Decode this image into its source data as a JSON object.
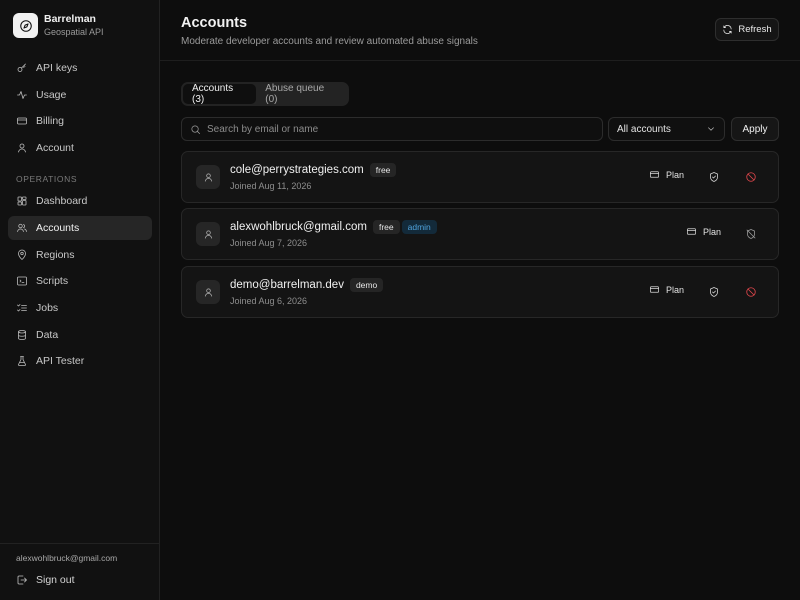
{
  "brand": {
    "name": "Barrelman",
    "subtitle": "Geospatial API",
    "logo_icon": "compass-icon"
  },
  "nav": {
    "items": [
      {
        "label": "API keys",
        "icon": "key-icon"
      },
      {
        "label": "Usage",
        "icon": "activity-icon"
      },
      {
        "label": "Billing",
        "icon": "credit-card-icon"
      },
      {
        "label": "Account",
        "icon": "user-icon"
      }
    ],
    "section_label": "OPERATIONS",
    "ops_items": [
      {
        "label": "Dashboard",
        "icon": "dashboard-icon"
      },
      {
        "label": "Accounts",
        "icon": "users-icon",
        "active": true
      },
      {
        "label": "Regions",
        "icon": "map-pin-icon"
      },
      {
        "label": "Scripts",
        "icon": "code-icon"
      },
      {
        "label": "Jobs",
        "icon": "list-checks-icon"
      },
      {
        "label": "Data",
        "icon": "database-icon"
      },
      {
        "label": "API Tester",
        "icon": "flask-icon"
      }
    ]
  },
  "footer": {
    "user_email": "alexwohlbruck@gmail.com",
    "signout_label": "Sign out"
  },
  "header": {
    "title": "Accounts",
    "subtitle": "Moderate developer accounts and review automated abuse signals",
    "refresh_label": "Refresh"
  },
  "tabs": [
    {
      "label": "Accounts (3)",
      "active": true
    },
    {
      "label": "Abuse queue (0)",
      "active": false
    }
  ],
  "filters": {
    "search_placeholder": "Search by email or name",
    "search_value": "",
    "select_value": "All accounts",
    "apply_label": "Apply"
  },
  "accounts": [
    {
      "email": "cole@perrystrategies.com",
      "badges": [
        "free"
      ],
      "joined": "Joined Aug 11, 2026",
      "plan_label": "Plan",
      "actions": [
        "grant-admin",
        "ban"
      ]
    },
    {
      "email": "alexwohlbruck@gmail.com",
      "badges": [
        "free",
        "admin"
      ],
      "joined": "Joined Aug 7, 2026",
      "plan_label": "Plan",
      "actions": [
        "revoke-admin"
      ]
    },
    {
      "email": "demo@barrelman.dev",
      "badges": [
        "demo"
      ],
      "joined": "Joined Aug 6, 2026",
      "plan_label": "Plan",
      "actions": [
        "grant-admin",
        "ban"
      ]
    }
  ],
  "colors": {
    "background": "#0d0d0d",
    "sidebar": "#111111",
    "danger": "#e5484d",
    "admin_badge": "#4fa3dd"
  }
}
